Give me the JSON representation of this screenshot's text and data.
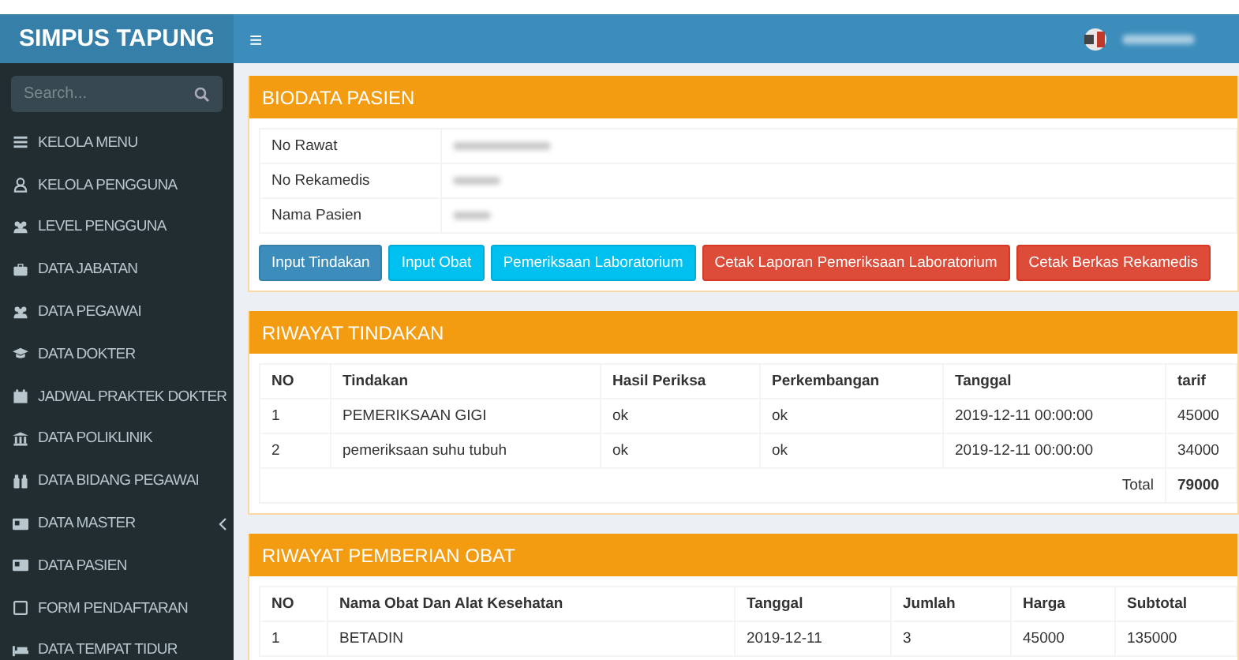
{
  "brand": "SIMPUS TAPUNG",
  "sidebar": {
    "search": {
      "placeholder": "Search..."
    },
    "items": [
      {
        "label": "KELOLA MENU",
        "submenu": false
      },
      {
        "label": "KELOLA PENGGUNA",
        "submenu": false
      },
      {
        "label": "LEVEL PENGGUNA",
        "submenu": false
      },
      {
        "label": "DATA JABATAN",
        "submenu": false
      },
      {
        "label": "DATA PEGAWAI",
        "submenu": false
      },
      {
        "label": "DATA DOKTER",
        "submenu": false
      },
      {
        "label": "JADWAL PRAKTEK DOKTER",
        "submenu": false
      },
      {
        "label": "DATA POLIKLINIK",
        "submenu": false
      },
      {
        "label": "DATA BIDANG PEGAWAI",
        "submenu": false
      },
      {
        "label": "DATA MASTER",
        "submenu": true
      },
      {
        "label": "DATA PASIEN",
        "submenu": false
      },
      {
        "label": "FORM PENDAFTARAN",
        "submenu": false
      },
      {
        "label": "DATA TEMPAT TIDUR",
        "submenu": false
      }
    ]
  },
  "topbar": {
    "menu_toggle": "≡"
  },
  "biodata": {
    "title": "BIODATA PASIEN",
    "fields": [
      {
        "label": "No Rawat"
      },
      {
        "label": "No Rekamedis"
      },
      {
        "label": "Nama Pasien"
      }
    ],
    "buttons": [
      {
        "label": "Input Tindakan",
        "kind": "primary"
      },
      {
        "label": "Input Obat",
        "kind": "info"
      },
      {
        "label": "Pemeriksaan Laboratorium",
        "kind": "info"
      },
      {
        "label": "Cetak Laporan Pemeriksaan Laboratorium",
        "kind": "danger"
      },
      {
        "label": "Cetak Berkas Rekamedis",
        "kind": "danger"
      }
    ]
  },
  "tindakan": {
    "title": "RIWAYAT TINDAKAN",
    "columns": [
      "NO",
      "Tindakan",
      "Hasil Periksa",
      "Perkembangan",
      "Tanggal",
      "tarif"
    ],
    "rows": [
      [
        "1",
        "PEMERIKSAAN GIGI",
        "ok",
        "ok",
        "2019-12-11 00:00:00",
        "45000"
      ],
      [
        "2",
        "pemeriksaan suhu tubuh",
        "ok",
        "ok",
        "2019-12-11 00:00:00",
        "34000"
      ]
    ],
    "total_label": "Total",
    "total": "79000"
  },
  "obat": {
    "title": "RIWAYAT PEMBERIAN OBAT",
    "columns": [
      "NO",
      "Nama Obat Dan Alat Kesehatan",
      "Tanggal",
      "Jumlah",
      "Harga",
      "Subtotal"
    ],
    "rows": [
      [
        "1",
        "BETADIN",
        "2019-12-11",
        "3",
        "45000",
        "135000"
      ]
    ]
  }
}
